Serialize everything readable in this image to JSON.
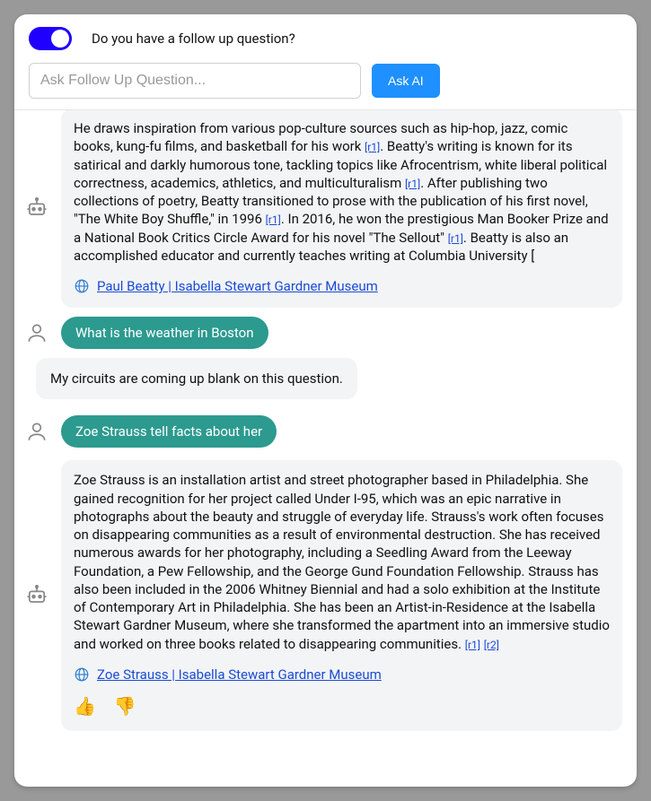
{
  "header": {
    "toggle_on": true,
    "toggle_label": "Do you have a follow up question?",
    "input_placeholder": "Ask Follow Up Question...",
    "ask_button": "Ask AI"
  },
  "refs": {
    "r1": "[r1]",
    "r2": "[r2]"
  },
  "beatty": {
    "seg1": "He draws inspiration from various pop-culture sources such as hip-hop, jazz, comic books, kung-fu films, and basketball for his work ",
    "seg2": ". Beatty's writing is known for its satirical and darkly humorous tone, tackling topics like Afrocentrism, white liberal political correctness, academics, athletics, and multiculturalism ",
    "seg3": ". After publishing two collections of poetry, Beatty transitioned to prose with the publication of his first novel, \"The White Boy Shuffle,\" in 1996 ",
    "seg4": ". In 2016, he won the prestigious Man Booker Prize and a National Book Critics Circle Award for his novel \"The Sellout\" ",
    "seg5": ". Beatty is also an accomplished educator and currently teaches writing at Columbia University [",
    "source": "Paul Beatty | Isabella Stewart Gardner Museum"
  },
  "user_q1": "What is the weather in Boston",
  "bot_blank": "My circuits are coming up blank on this question.",
  "user_q2": "Zoe Strauss tell facts about her",
  "strauss": {
    "seg1": "Zoe Strauss is an installation artist and street photographer based in Philadelphia. She gained recognition for her project called Under I-95, which was an epic narrative in photographs about the beauty and struggle of everyday life. Strauss's work often focuses on disappearing communities as a result of environmental destruction. She has received numerous awards for her photography, including a Seedling Award from the Leeway Foundation, a Pew Fellowship, and the George Gund Foundation Fellowship. Strauss has also been included in the 2006 Whitney Biennial and had a solo exhibition at the Institute of Contemporary Art in Philadelphia. She has been an Artist-in-Residence at the Isabella Stewart Gardner Museum, where she transformed the apartment into an immersive studio and worked on three books related to disappearing communities. ",
    "source": "Zoe Strauss | Isabella Stewart Gardner Museum"
  },
  "feedback": {
    "up": "👍",
    "down": "👎"
  }
}
